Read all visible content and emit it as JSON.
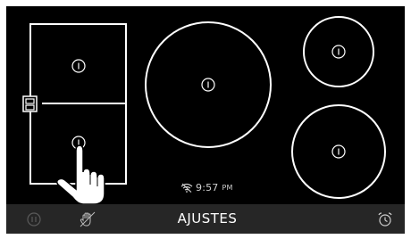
{
  "status": {
    "time": "9:57",
    "period": "PM"
  },
  "bottom_bar": {
    "settings_label": "AJUSTES"
  },
  "icons": {
    "burner_power": "power-icon",
    "wifi": "wifi-off-icon",
    "pause": "pause-icon",
    "lock": "hand-lock-icon",
    "timer": "alarm-clock-icon",
    "bridge": "bridge-toggle-icon",
    "hand": "pointing-hand-icon"
  },
  "colors": {
    "background": "#000000",
    "outline": "#ffffff",
    "bar": "#262626",
    "disabled_icon": "#5a5a5a"
  }
}
